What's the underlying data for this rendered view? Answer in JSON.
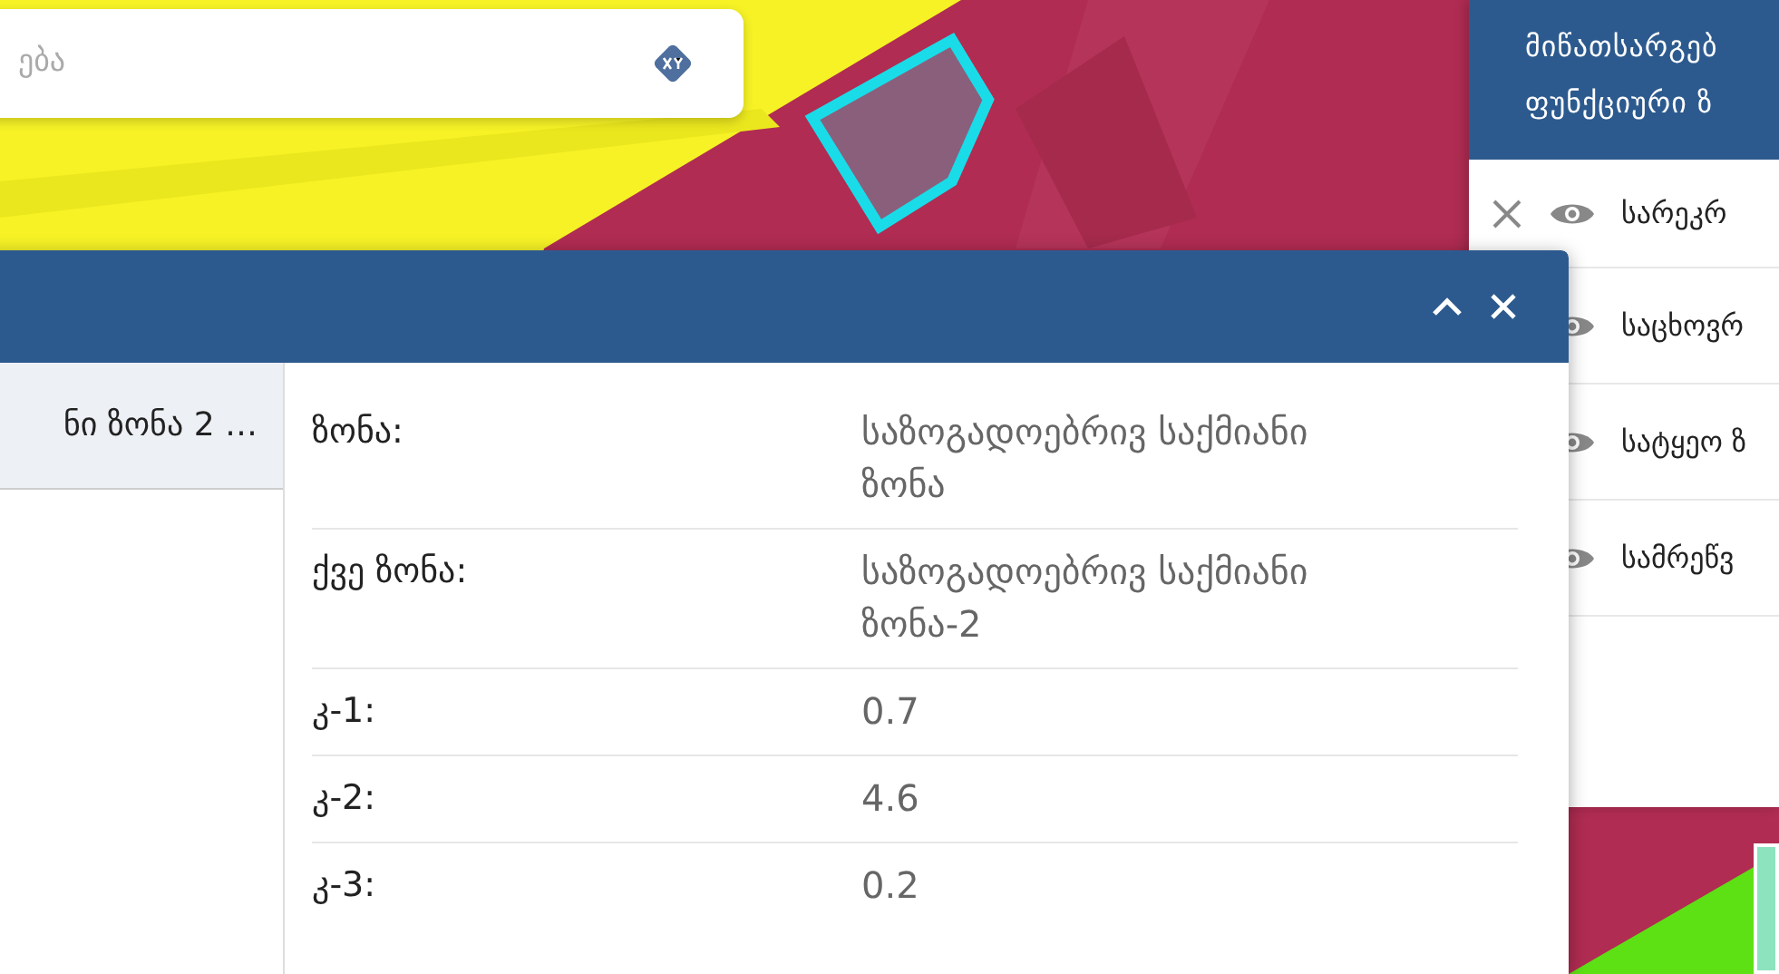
{
  "search": {
    "placeholder": "ება"
  },
  "layers_panel": {
    "title_lines": [
      "მიწათსარგებ",
      "ფუნქციური ზ"
    ],
    "items": [
      {
        "label": "სარეკრ",
        "visible": true
      },
      {
        "label": "საცხოვრ",
        "visible": true
      },
      {
        "label": "სატყეო ზ",
        "visible": true
      },
      {
        "label": "სამრეწვ",
        "visible": true
      }
    ]
  },
  "info_popup": {
    "list": [
      {
        "label": "ნი ზონა 2 …",
        "selected": true
      }
    ],
    "properties": [
      {
        "label": "ზონა:",
        "value": "საზოგადოებრივ საქმიანი ზონა"
      },
      {
        "label": "ქვე ზონა:",
        "value": "საზოგადოებრივ საქმიანი ზონა-2"
      },
      {
        "label": "კ-1:",
        "value": "0.7"
      },
      {
        "label": "კ-2:",
        "value": "4.6"
      },
      {
        "label": "კ-3:",
        "value": "0.2"
      }
    ]
  }
}
